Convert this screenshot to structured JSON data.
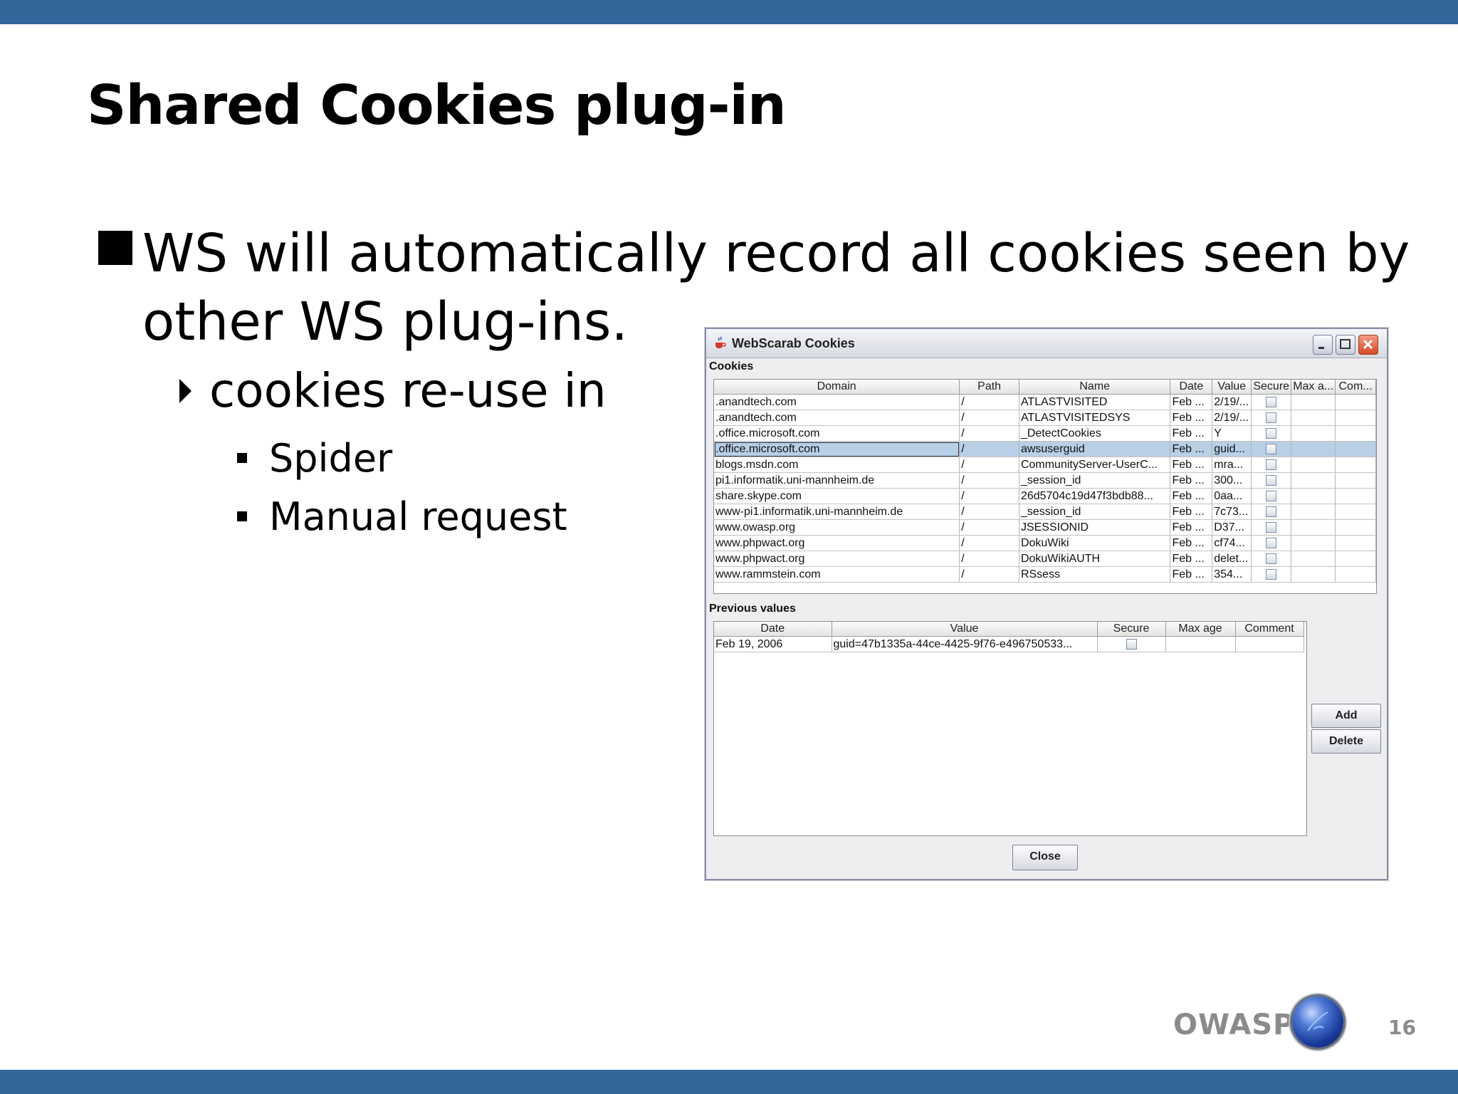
{
  "slide": {
    "title": "Shared Cookies plug-in",
    "bullet1_line1": "WS will automatically record all cookies seen by",
    "bullet1_line2": "other WS plug-ins.",
    "bullet2": "cookies re-use in",
    "bullet3a": "Spider",
    "bullet3b": "Manual request",
    "footer_brand": "OWASP",
    "page_number": "16",
    "colors": {
      "bar": "#33669b",
      "footer_text": "#8b8b8b"
    }
  },
  "window": {
    "title": "WebScarab Cookies",
    "cookies_label": "Cookies",
    "cookie_columns": [
      "Domain",
      "Path",
      "Name",
      "Date",
      "Value",
      "Secure",
      "Max a...",
      "Com..."
    ],
    "cookies": [
      {
        "domain": ".anandtech.com",
        "path": "/",
        "name": "ATLASTVISITED",
        "date": "Feb ...",
        "value": "2/19/..."
      },
      {
        "domain": ".anandtech.com",
        "path": "/",
        "name": "ATLASTVISITEDSYS",
        "date": "Feb ...",
        "value": "2/19/..."
      },
      {
        "domain": ".office.microsoft.com",
        "path": "/",
        "name": "_DetectCookies",
        "date": "Feb ...",
        "value": "Y"
      },
      {
        "domain": ".office.microsoft.com",
        "path": "/",
        "name": "awsuserguid",
        "date": "Feb ...",
        "value": "guid..."
      },
      {
        "domain": "blogs.msdn.com",
        "path": "/",
        "name": "CommunityServer-UserC...",
        "date": "Feb ...",
        "value": "mra..."
      },
      {
        "domain": "pi1.informatik.uni-mannheim.de",
        "path": "/",
        "name": "_session_id",
        "date": "Feb ...",
        "value": "300..."
      },
      {
        "domain": "share.skype.com",
        "path": "/",
        "name": "26d5704c19d47f3bdb88...",
        "date": "Feb ...",
        "value": "0aa..."
      },
      {
        "domain": "www-pi1.informatik.uni-mannheim.de",
        "path": "/",
        "name": "_session_id",
        "date": "Feb ...",
        "value": "7c73..."
      },
      {
        "domain": "www.owasp.org",
        "path": "/",
        "name": "JSESSIONID",
        "date": "Feb ...",
        "value": "D37..."
      },
      {
        "domain": "www.phpwact.org",
        "path": "/",
        "name": "DokuWiki",
        "date": "Feb ...",
        "value": "cf74..."
      },
      {
        "domain": "www.phpwact.org",
        "path": "/",
        "name": "DokuWikiAUTH",
        "date": "Feb ...",
        "value": "delet..."
      },
      {
        "domain": "www.rammstein.com",
        "path": "/",
        "name": "RSsess",
        "date": "Feb ...",
        "value": "354..."
      }
    ],
    "previous_label": "Previous values",
    "previous_columns": [
      "Date",
      "Value",
      "Secure",
      "Max age",
      "Comment"
    ],
    "previous": [
      {
        "date": "Feb 19, 2006",
        "value": "guid=47b1335a-44ce-4425-9f76-e496750533..."
      }
    ],
    "buttons": {
      "add": "Add",
      "delete": "Delete",
      "close": "Close"
    }
  }
}
